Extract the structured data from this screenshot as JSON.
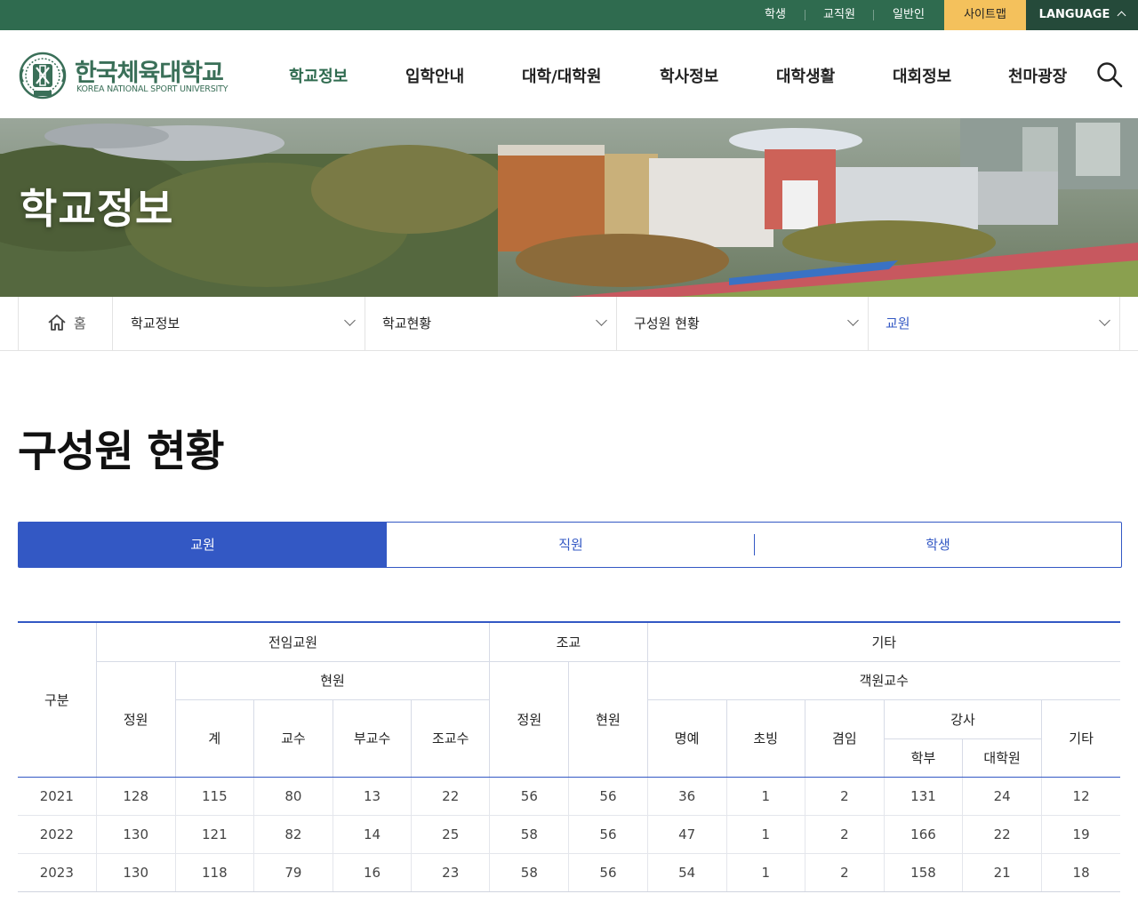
{
  "utility": {
    "links": [
      "학생",
      "교직원",
      "일반인"
    ],
    "sitemap": "사이트맵",
    "language": "LANGUAGE"
  },
  "logo": {
    "name_kr": "한국체육대학교",
    "name_en": "KOREA NATIONAL SPORT UNIVERSITY",
    "color": "#3a6f58"
  },
  "gnb": {
    "items": [
      "학교정보",
      "입학안내",
      "대학/대학원",
      "학사정보",
      "대학생활",
      "대회정보",
      "천마광장"
    ],
    "active_index": 0
  },
  "banner": {
    "title": "학교정보"
  },
  "breadcrumb": {
    "home": "홈",
    "items": [
      "학교정보",
      "학교현황",
      "구성원 현황",
      "교원"
    ]
  },
  "page": {
    "title": "구성원 현황"
  },
  "tabs": {
    "items": [
      "교원",
      "직원",
      "학생"
    ],
    "active_index": 0
  },
  "table": {
    "headers": {
      "category": "구분",
      "fulltime": "전임교원",
      "assistant": "조교",
      "other": "기타",
      "quota": "정원",
      "current": "현원",
      "total": "계",
      "professor": "교수",
      "associate": "부교수",
      "assistant_prof": "조교수",
      "asst_quota": "정원",
      "asst_current": "현원",
      "visiting": "객원교수",
      "emeritus": "명예",
      "invited": "초빙",
      "adjunct": "겸임",
      "lecturer": "강사",
      "undergrad": "학부",
      "graduate": "대학원",
      "etc": "기타"
    },
    "rows": [
      [
        "2021",
        "128",
        "115",
        "80",
        "13",
        "22",
        "56",
        "56",
        "36",
        "1",
        "2",
        "131",
        "24",
        "12"
      ],
      [
        "2022",
        "130",
        "121",
        "82",
        "14",
        "25",
        "58",
        "56",
        "47",
        "1",
        "2",
        "166",
        "22",
        "19"
      ],
      [
        "2023",
        "130",
        "118",
        "79",
        "16",
        "23",
        "58",
        "56",
        "54",
        "1",
        "2",
        "158",
        "21",
        "18"
      ]
    ]
  },
  "colors": {
    "utility_bar": "#2f6b4f",
    "sitemap": "#f4c15c",
    "accent_blue": "#3358c4"
  }
}
